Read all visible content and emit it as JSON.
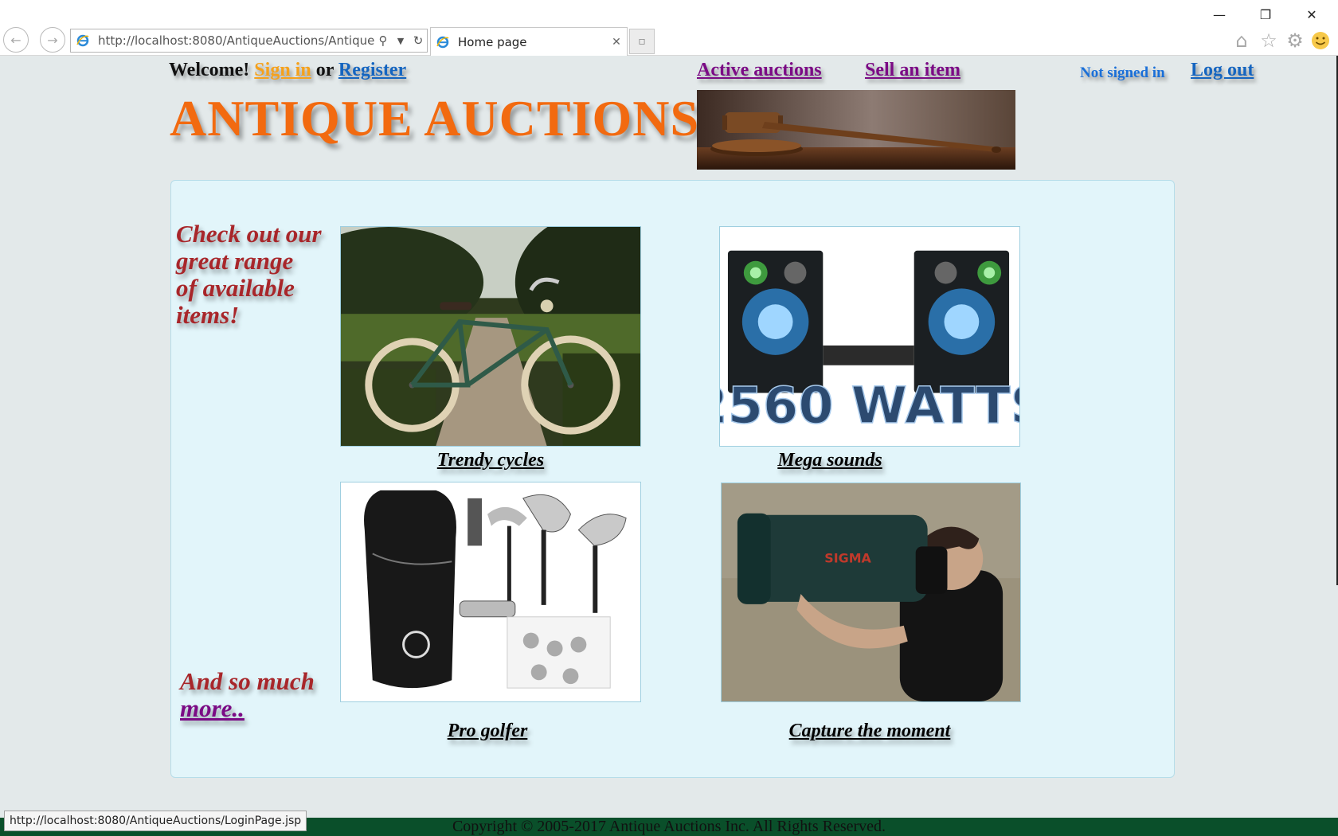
{
  "browser": {
    "address_url": "http://localhost:8080/AntiqueAuctions/AntiqueAuc",
    "tab_title": "Home page",
    "tab_close": "✕",
    "new_tab": "▫",
    "status_url": "http://localhost:8080/AntiqueAuctions/LoginPage.jsp"
  },
  "header": {
    "welcome_text": "Welcome!",
    "sign_in": "Sign in",
    "or_text": "or",
    "register": "Register",
    "active_auctions": "Active auctions",
    "sell_item": "Sell an item",
    "signed_status": "Not signed in",
    "log_out": "Log out",
    "site_title": "ANTIQUE AUCTIONS"
  },
  "promo": {
    "line1": "Check out our",
    "line2": "great range",
    "line3": "of available",
    "line4": "items!",
    "more_prefix": "And so much",
    "more_link": "more.."
  },
  "items": [
    {
      "caption": "Trendy cycles"
    },
    {
      "caption": "Mega sounds",
      "image_text": "2560 WATTS"
    },
    {
      "caption": "Pro golfer"
    },
    {
      "caption": "Capture the moment",
      "image_text": "SIGMA"
    }
  ],
  "footer": {
    "copyright": "Copyright © 2005-2017 Antique Auctions Inc. All Rights Reserved."
  },
  "colors": {
    "title_orange": "#f26a10",
    "promo_red": "#a8262a",
    "link_blue": "#1565c0",
    "link_purple": "#7b0b85",
    "link_orange": "#f5a11c",
    "page_bg": "#e3e9ea",
    "panel_bg": "#e2f5fa",
    "footer_green": "#0a4f2a"
  }
}
